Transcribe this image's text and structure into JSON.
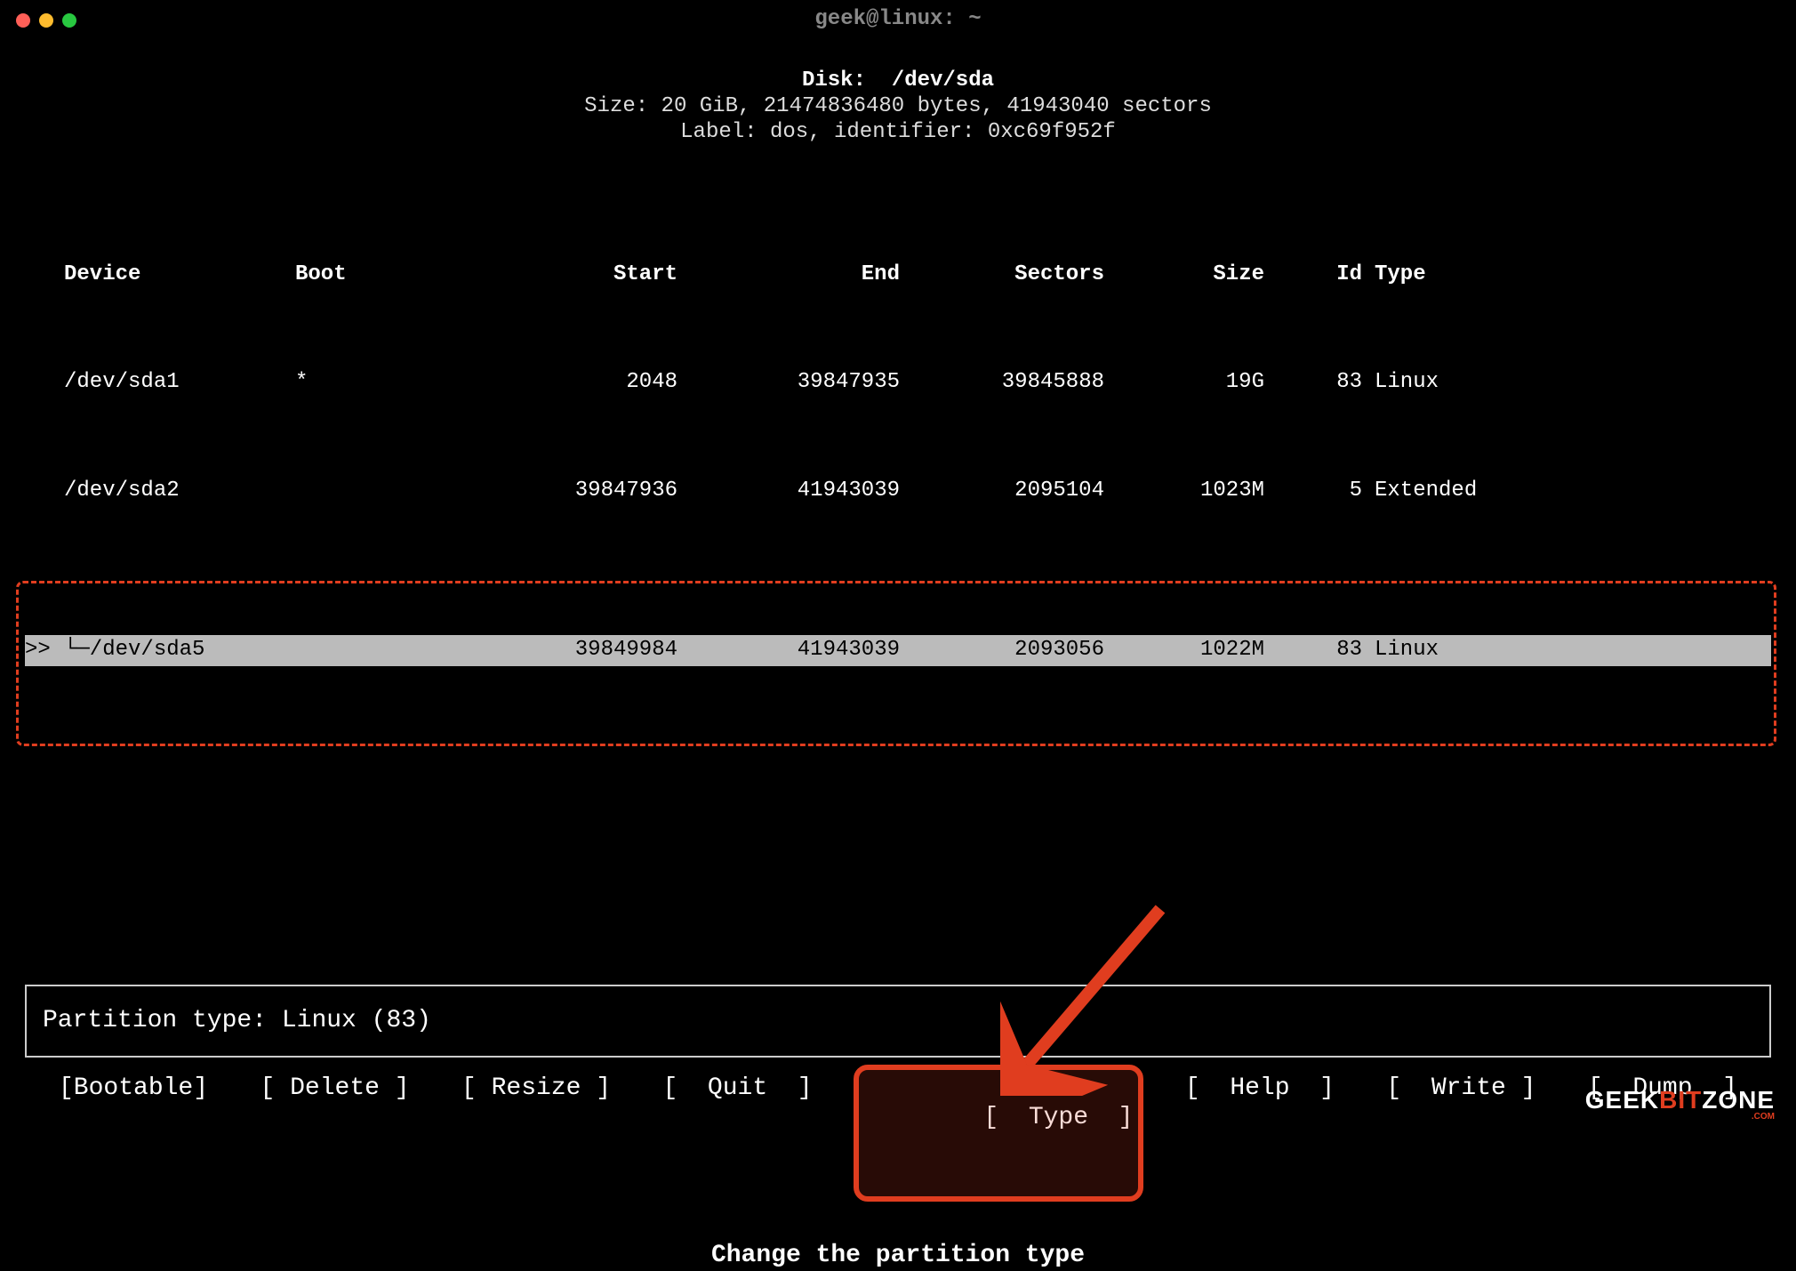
{
  "window": {
    "title": "geek@linux: ~"
  },
  "disk": {
    "header": "Disk:  /dev/sda",
    "size_line": "Size: 20 GiB, 21474836480 bytes, 41943040 sectors",
    "label_line": "Label: dos, identifier: 0xc69f952f"
  },
  "columns": {
    "device": "Device",
    "boot": "Boot",
    "start": "Start",
    "end": "End",
    "sectors": "Sectors",
    "size": "Size",
    "id": "Id",
    "type": "Type"
  },
  "rows": [
    {
      "marker": "",
      "device": "/dev/sda1",
      "boot": "*",
      "start": "2048",
      "end": "39847935",
      "sectors": "39845888",
      "size": "19G",
      "id": "83",
      "type": "Linux",
      "selected": false
    },
    {
      "marker": "",
      "device": "/dev/sda2",
      "boot": "",
      "start": "39847936",
      "end": "41943039",
      "sectors": "2095104",
      "size": "1023M",
      "id": "5",
      "type": "Extended",
      "selected": false
    },
    {
      "marker": ">>",
      "device_display": "└─/dev/sda5",
      "device": "/dev/sda5",
      "boot": "",
      "start": "39849984",
      "end": "41943039",
      "sectors": "2093056",
      "size": "1022M",
      "id": "83",
      "type": "Linux",
      "selected": true
    }
  ],
  "partition_type_line": "Partition type: Linux (83)",
  "menu": {
    "items": [
      {
        "label": "[Bootable]",
        "name": "bootable"
      },
      {
        "label": "[ Delete ]",
        "name": "delete"
      },
      {
        "label": "[ Resize ]",
        "name": "resize"
      },
      {
        "label": "[  Quit  ]",
        "name": "quit"
      },
      {
        "label": "[  Type  ]",
        "name": "type",
        "highlight": true
      },
      {
        "label": "[  Help  ]",
        "name": "help"
      },
      {
        "label": "[  Write ]",
        "name": "write"
      },
      {
        "label": "[  Dump  ]",
        "name": "dump"
      }
    ]
  },
  "hint": "Change the partition type",
  "watermark": {
    "pre": "GEEK",
    "accent": "BIT",
    "post": "ZONE",
    "sub": ".COM"
  },
  "annotation": {
    "highlight_color": "#e03d1f"
  }
}
